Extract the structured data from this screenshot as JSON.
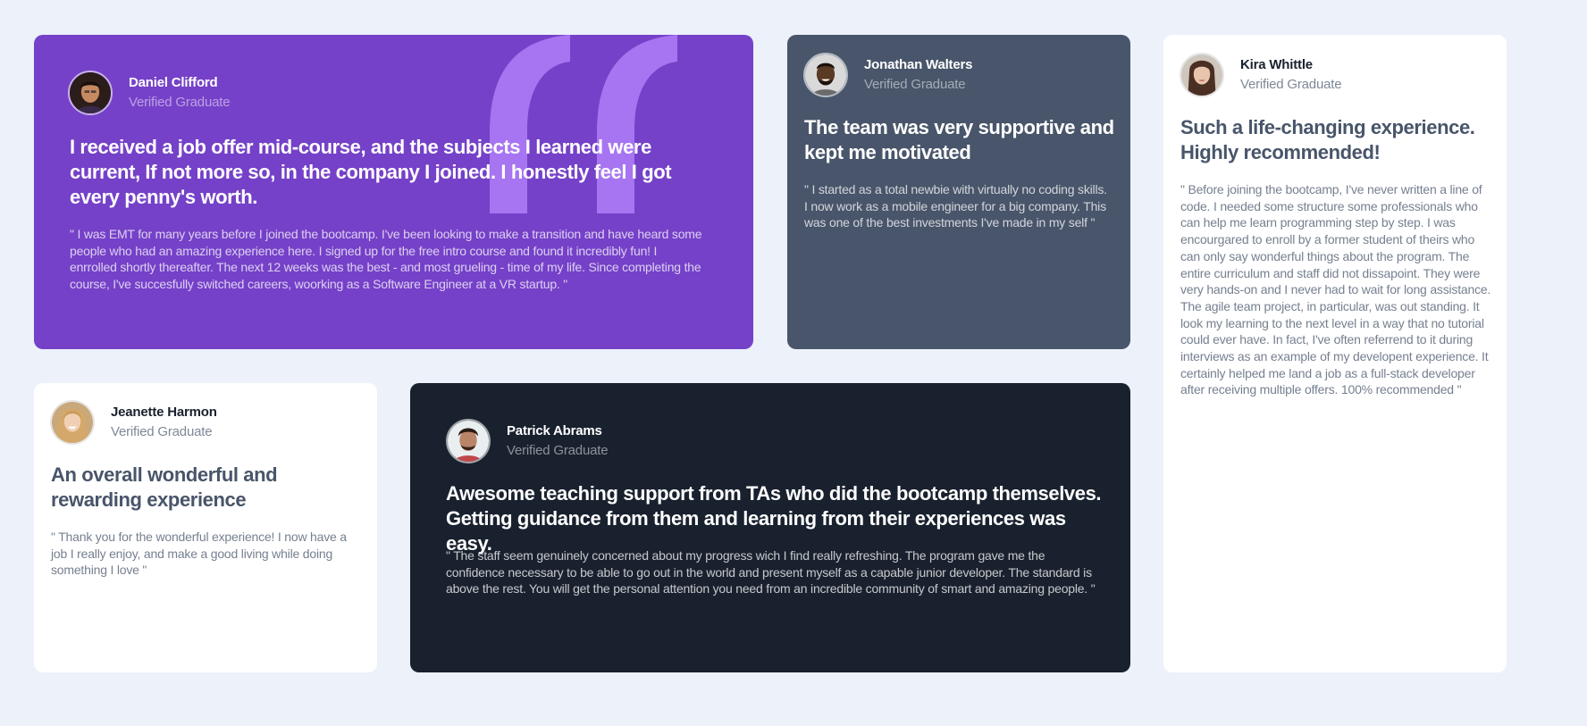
{
  "colors": {
    "background": "#ecf1fa",
    "purple": "#7541c8",
    "dark_grayish_blue": "#48556a",
    "very_dark_blue": "#19212e",
    "white": "#ffffff",
    "quote_mark": "#a775f1"
  },
  "testimonials": [
    {
      "name": "Daniel Clifford",
      "role": "Verified Graduate",
      "avatar_icon": "avatar-daniel",
      "headline": "I received a job offer mid-course, and the subjects I learned were current, If not more so, in the company I joined. I honestly feel I got every penny's worth.",
      "body": "\" I was EMT for many years before I joined the bootcamp. I've been looking to make a transition and have heard some people who had an amazing experience here. I signed up for the free intro course and found it incredibly fun! I enrrolled shortly thereafter. The next 12 weeks was the best - and most grueling - time of my life. Since completing the course, I've succesfully switched careers, woorking as a Software Engineer at a VR startup. \""
    },
    {
      "name": "Jonathan Walters",
      "role": "Verified Graduate",
      "avatar_icon": "avatar-jonathan",
      "headline": "The team was very supportive and kept me motivated",
      "body": "\" I started as a total newbie with virtually no coding skills. I now work as a mobile engineer for a big company. This was one of the best investments I've made in my self \""
    },
    {
      "name": "Kira Whittle",
      "role": "Verified Graduate",
      "avatar_icon": "avatar-kira",
      "headline": "Such a life-changing experience. Highly recommended!",
      "body": "\" Before joining the bootcamp, I've never written a line of code. I needed some structure some professionals who can help me learn programming step by step. I was encourgared to enroll by a former student of theirs who can only say wonderful things about the program. The entire curriculum and staff did not dissapoint. They were very hands-on and I never had to wait for long assistance. The agile team project, in particular, was out standing. It look my learning to the next level in a way that no tutorial could ever have. In fact, I've often referrend to it during interviews as an example of my developent experience. It certainly helped me land a job as a full-stack developer after receiving multiple offers. 100% recommended \""
    },
    {
      "name": "Jeanette Harmon",
      "role": "Verified Graduate",
      "avatar_icon": "avatar-jeanette",
      "headline": "An overall wonderful and rewarding experience",
      "body": "\" Thank you for the wonderful experience! I now have a job I really enjoy, and make a good living while doing something I love \""
    },
    {
      "name": "Patrick Abrams",
      "role": "Verified Graduate",
      "avatar_icon": "avatar-patrick",
      "headline": "Awesome teaching support from TAs who did the bootcamp themselves. Getting guidance from them and learning from their experiences was easy.",
      "body": "\" The staff seem genuinely concerned about my progress wich I find really refreshing. The program gave me the confidence necessary to be able to go out in the world and present myself as a capable junior developer. The standard is above the rest. You will get the personal attention you need from an incredible community of smart and amazing people. \""
    }
  ]
}
